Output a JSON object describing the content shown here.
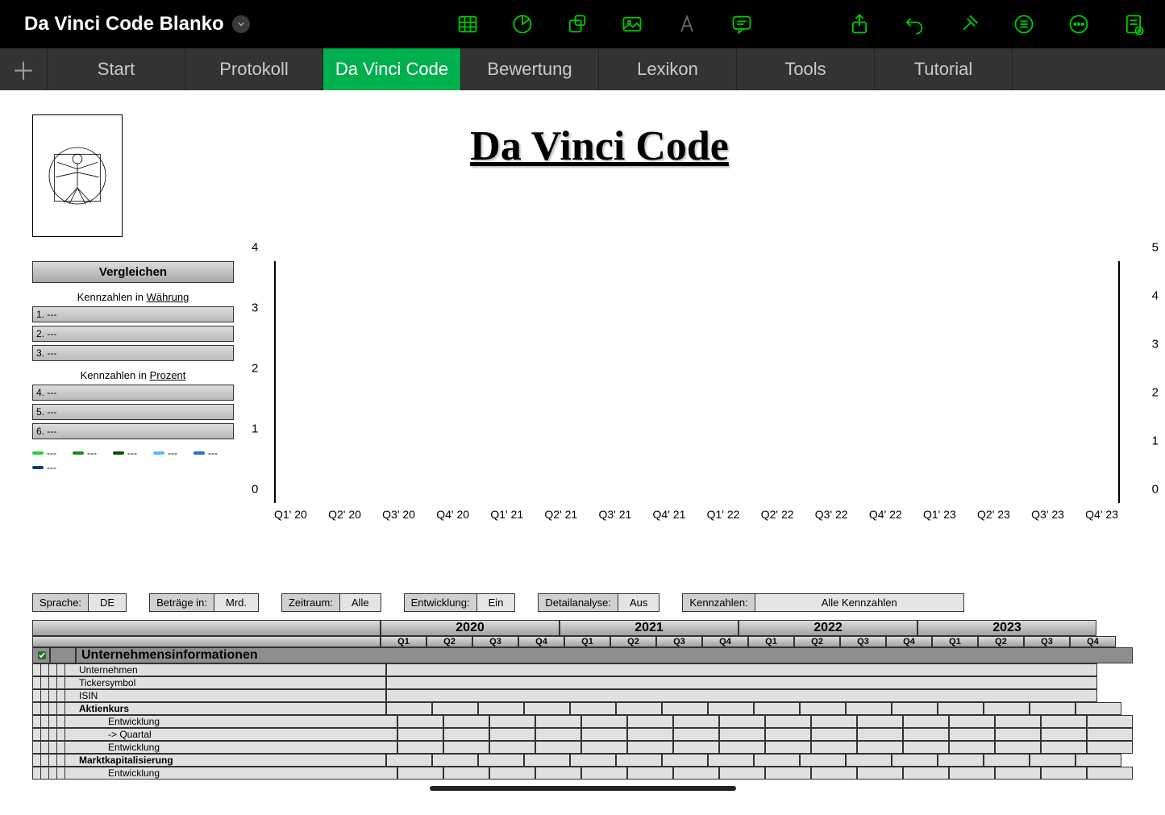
{
  "topbar": {
    "title": "Da Vinci Code Blanko"
  },
  "tabs": {
    "items": [
      "Start",
      "Protokoll",
      "Da Vinci Code",
      "Bewertung",
      "Lexikon",
      "Tools",
      "Tutorial"
    ],
    "active": 2
  },
  "page": {
    "title": "Da Vinci Code"
  },
  "side": {
    "compare": "Vergleichen",
    "group1_label_a": "Kennzahlen in  ",
    "group1_label_b": "Währung",
    "rows1": [
      "1.    ---",
      "2.    ---",
      "3.    ---"
    ],
    "group2_label_a": "Kennzahlen in  ",
    "group2_label_b": "Prozent",
    "rows2": [
      "4.    ---",
      "5.    ---",
      "6.    ---"
    ],
    "legend": [
      {
        "color": "#2ecc40",
        "label": "---"
      },
      {
        "color": "#1b8a1b",
        "label": "---"
      },
      {
        "color": "#0b4f0b",
        "label": "---"
      },
      {
        "color": "#58b7ff",
        "label": "---"
      },
      {
        "color": "#1d6fd6",
        "label": "---"
      },
      {
        "color": "#0b3d78",
        "label": "---"
      }
    ]
  },
  "chart_data": {
    "type": "line",
    "series": [],
    "x_categories": [
      "Q1' 20",
      "Q2' 20",
      "Q3' 20",
      "Q4' 20",
      "Q1' 21",
      "Q2' 21",
      "Q3' 21",
      "Q4' 21",
      "Q1' 22",
      "Q2' 22",
      "Q3' 22",
      "Q4' 22",
      "Q1' 23",
      "Q2' 23",
      "Q3' 23",
      "Q4' 23"
    ],
    "y_left": {
      "min": 0,
      "max": 4,
      "ticks": [
        0,
        1,
        2,
        3,
        4
      ]
    },
    "y_right": {
      "min": 0,
      "max": 5,
      "ticks": [
        0,
        1,
        2,
        3,
        4,
        5
      ]
    },
    "title": ""
  },
  "filters": {
    "sprache": {
      "label": "Sprache:",
      "value": "DE"
    },
    "betraege": {
      "label": "Beträge in:",
      "value": "Mrd."
    },
    "zeitraum": {
      "label": "Zeitraum:",
      "value": "Alle"
    },
    "entwicklung": {
      "label": "Entwicklung:",
      "value": "Ein"
    },
    "detail": {
      "label": "Detailanalyse:",
      "value": "Aus"
    },
    "kennzahlen": {
      "label": "Kennzahlen:",
      "value": "Alle Kennzahlen"
    }
  },
  "table": {
    "years": [
      "2020",
      "2021",
      "2022",
      "2023"
    ],
    "quarters": [
      "Q1",
      "Q2",
      "Q3",
      "Q4"
    ],
    "section": "Unternehmensinformationen",
    "rows": [
      {
        "label": "Unternehmen",
        "indent": 1,
        "merged": true
      },
      {
        "label": "Tickersymbol",
        "indent": 1,
        "merged": true
      },
      {
        "label": "ISIN",
        "indent": 1,
        "merged": true
      },
      {
        "label": "Aktienkurs",
        "indent": 1,
        "merged": false,
        "bold": true
      },
      {
        "label": "Entwicklung",
        "indent": 2,
        "merged": false
      },
      {
        "label": "-> Quartal",
        "indent": 2,
        "merged": false
      },
      {
        "label": "Entwicklung",
        "indent": 2,
        "merged": false
      },
      {
        "label": "Marktkapitalisierung",
        "indent": 1,
        "merged": false,
        "bold": true
      },
      {
        "label": "Entwicklung",
        "indent": 2,
        "merged": false
      }
    ]
  }
}
